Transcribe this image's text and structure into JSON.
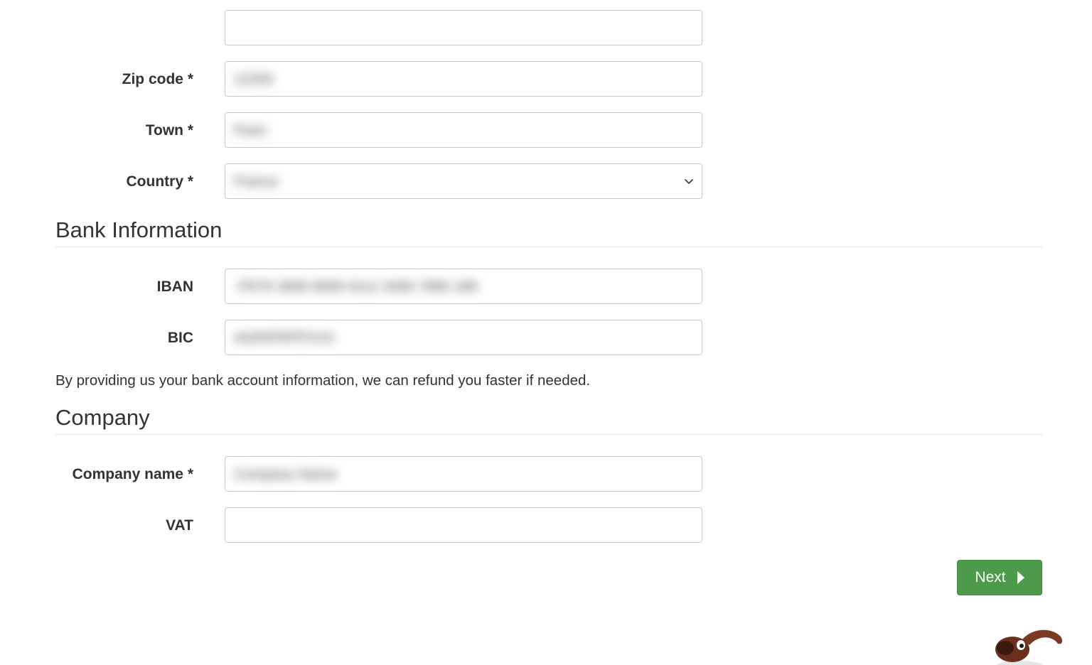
{
  "address": {
    "top_field_value": "",
    "zip": {
      "label": "Zip code *",
      "value": "12345"
    },
    "town": {
      "label": "Town *",
      "value": "Paris"
    },
    "country": {
      "label": "Country *",
      "value": "France"
    }
  },
  "bank": {
    "title": "Bank Information",
    "iban": {
      "label": "IBAN",
      "value": "FR76 3000 6000 0112 3456 7890 189"
    },
    "bic": {
      "label": "BIC",
      "value": "AGRIFRPPXXX"
    },
    "note": "By providing us your bank account information, we can refund you faster if needed."
  },
  "company": {
    "title": "Company",
    "name": {
      "label": "Company name *",
      "value": "Company Name"
    },
    "vat": {
      "label": "VAT",
      "value": ""
    }
  },
  "actions": {
    "next_label": "Next"
  },
  "colors": {
    "primary_button": "#4e9a4b",
    "border": "#c8c8c8",
    "text": "#333333"
  }
}
